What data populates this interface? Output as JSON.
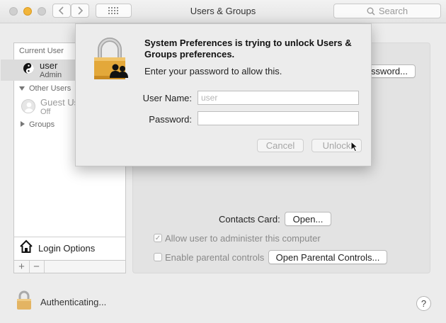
{
  "window": {
    "title": "Users & Groups",
    "search_placeholder": "Search"
  },
  "sidebar": {
    "current_user_header": "Current User",
    "current_user": {
      "name": "user",
      "role": "Admin"
    },
    "other_users_header": "Other Users",
    "guest": {
      "name": "Guest Us",
      "status": "Off"
    },
    "groups_label": "Groups",
    "login_options": "Login Options",
    "add_symbol": "+",
    "remove_symbol": "−"
  },
  "panel": {
    "change_password_button": "ssword...",
    "contacts_card_label": "Contacts Card:",
    "open_button": "Open...",
    "allow_admin_label": "Allow user to administer this computer",
    "allow_admin_checked": true,
    "parental_controls_label": "Enable parental controls",
    "parental_controls_checked": false,
    "open_parental_button": "Open Parental Controls..."
  },
  "dialog": {
    "title": "System Preferences is trying to unlock Users & Groups preferences.",
    "message": "Enter your password to allow this.",
    "username_label": "User Name:",
    "username_placeholder": "user",
    "password_label": "Password:",
    "password_value": "",
    "cancel_button": "Cancel",
    "unlock_button": "Unlock"
  },
  "footer": {
    "status": "Authenticating...",
    "help_symbol": "?"
  },
  "colors": {
    "lock_gold": "#e3a83a",
    "traffic_yellow": "#f2b53a"
  }
}
